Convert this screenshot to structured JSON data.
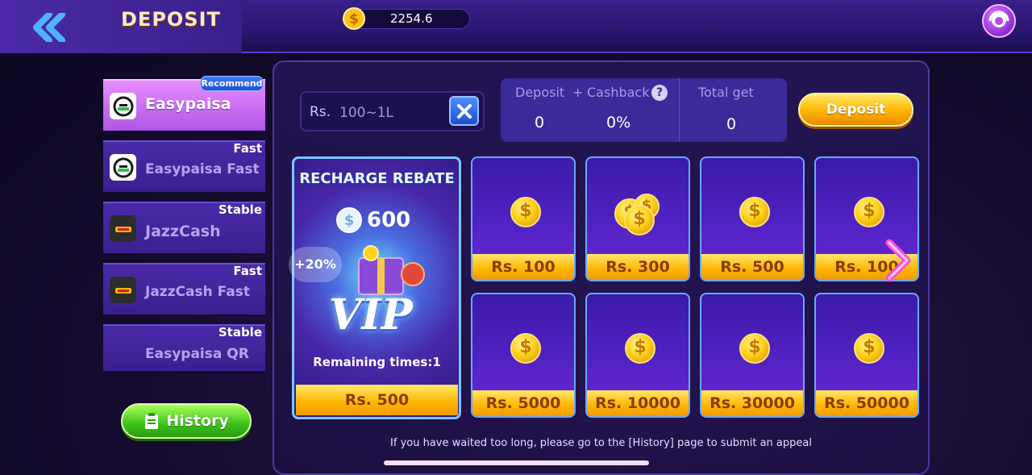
{
  "header": {
    "title": "DEPOSIT",
    "balance": "2254.6"
  },
  "sidebar": {
    "recommend_badge": "Recommend",
    "items": [
      {
        "label": "Easypaisa",
        "tag": "",
        "logo": "easypaisa-logo",
        "active": true
      },
      {
        "label": "Easypaisa Fast",
        "tag": "Fast",
        "logo": "easypaisa-logo",
        "active": false
      },
      {
        "label": "JazzCash",
        "tag": "Stable",
        "logo": "jazzcash-logo",
        "active": false
      },
      {
        "label": "JazzCash Fast",
        "tag": "Fast",
        "logo": "jazzcash-logo",
        "active": false
      },
      {
        "label": "Easypaisa QR",
        "tag": "Stable",
        "logo": "",
        "active": false
      }
    ],
    "history_label": "History"
  },
  "form": {
    "currency_prefix": "Rs.",
    "amount_placeholder": "100~1L",
    "deposit_label": "Deposit",
    "plus_sign": "+",
    "summary": {
      "deposit_label": "Deposit",
      "deposit_value": "0",
      "cashback_label": "Cashback",
      "cashback_value": "0%",
      "total_label": "Total get",
      "total_value": "0"
    }
  },
  "vip_card": {
    "title": "RECHARGE REBATE",
    "coin_value": "600",
    "bonus": "+20%",
    "word": "VIP",
    "remaining": "Remaining times:1",
    "amount": "Rs. 500"
  },
  "amounts": [
    "Rs. 100",
    "Rs. 300",
    "Rs. 500",
    "Rs. 100",
    "Rs. 5000",
    "Rs. 10000",
    "Rs. 30000",
    "Rs. 50000"
  ],
  "appeal_text": "If you have waited too long, please go to the [History] page to submit an appeal",
  "colors": {
    "accent_purple": "#3a1f8a",
    "gold": "#ffb400",
    "green": "#3dc21a",
    "active_item": "#e88dff"
  }
}
